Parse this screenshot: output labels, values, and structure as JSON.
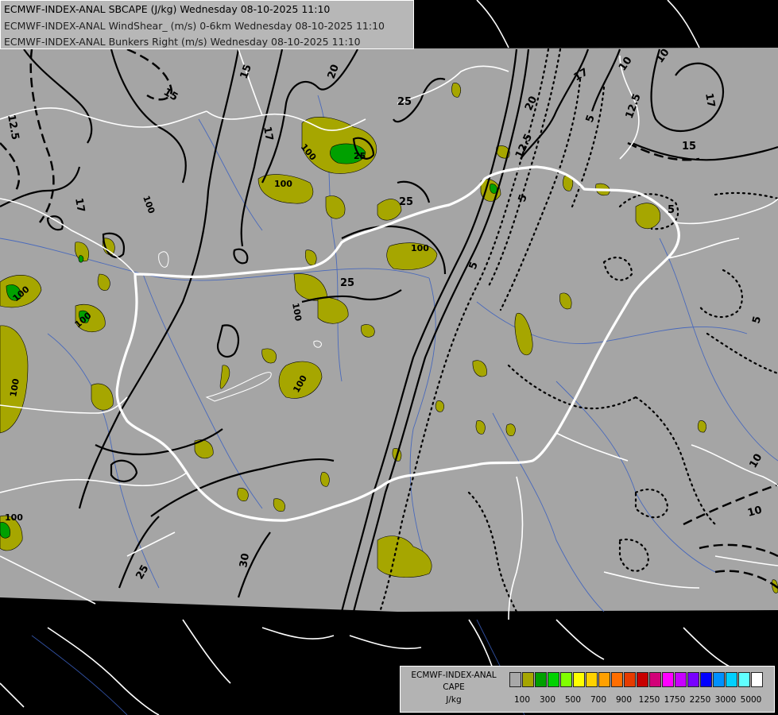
{
  "titles": [
    "ECMWF-INDEX-ANAL SBCAPE (J/kg) Wednesday 08-10-2025 11:10",
    "ECMWF-INDEX-ANAL WindShear_ (m/s) 0-6km Wednesday 08-10-2025 11:10",
    "ECMWF-INDEX-ANAL Bunkers Right (m/s) Wednesday 08-10-2025 11:10"
  ],
  "legend": {
    "title_lines": [
      "ECMWF-INDEX-ANAL",
      "CAPE",
      "J/kg"
    ],
    "colors": [
      "#a8a8a8",
      "#a6a600",
      "#00a000",
      "#00d200",
      "#80ff00",
      "#ffff00",
      "#ffd200",
      "#ffa000",
      "#ff6e00",
      "#e63c00",
      "#c80000",
      "#d20078",
      "#ff00ff",
      "#c800ff",
      "#7800ff",
      "#0000ff",
      "#0090ff",
      "#00d0ff",
      "#60ffff",
      "#ffffff"
    ],
    "tick_labels": [
      "100",
      "300",
      "500",
      "700",
      "900",
      "1250",
      "1750",
      "2250",
      "3000",
      "5000"
    ]
  },
  "contour_labels": [
    "15",
    "15",
    "20",
    "25",
    "17",
    "10",
    "12.5",
    "10",
    "17",
    "15",
    "12.5",
    "20",
    "25",
    "100",
    "100",
    "100",
    "25",
    "25",
    "100",
    "100",
    "100",
    "100",
    "100",
    "100",
    "100",
    "17",
    "12.5",
    "5",
    "5",
    "5",
    "5",
    "10",
    "10",
    "30",
    "25",
    "17",
    "5"
  ],
  "colors": {
    "domain_gray": "#a5a5a5",
    "outside": "#000000",
    "cape_low": "#a6a600",
    "cape_mid": "#00a000",
    "border": "#ffffff",
    "river": "#3a5fbf"
  }
}
